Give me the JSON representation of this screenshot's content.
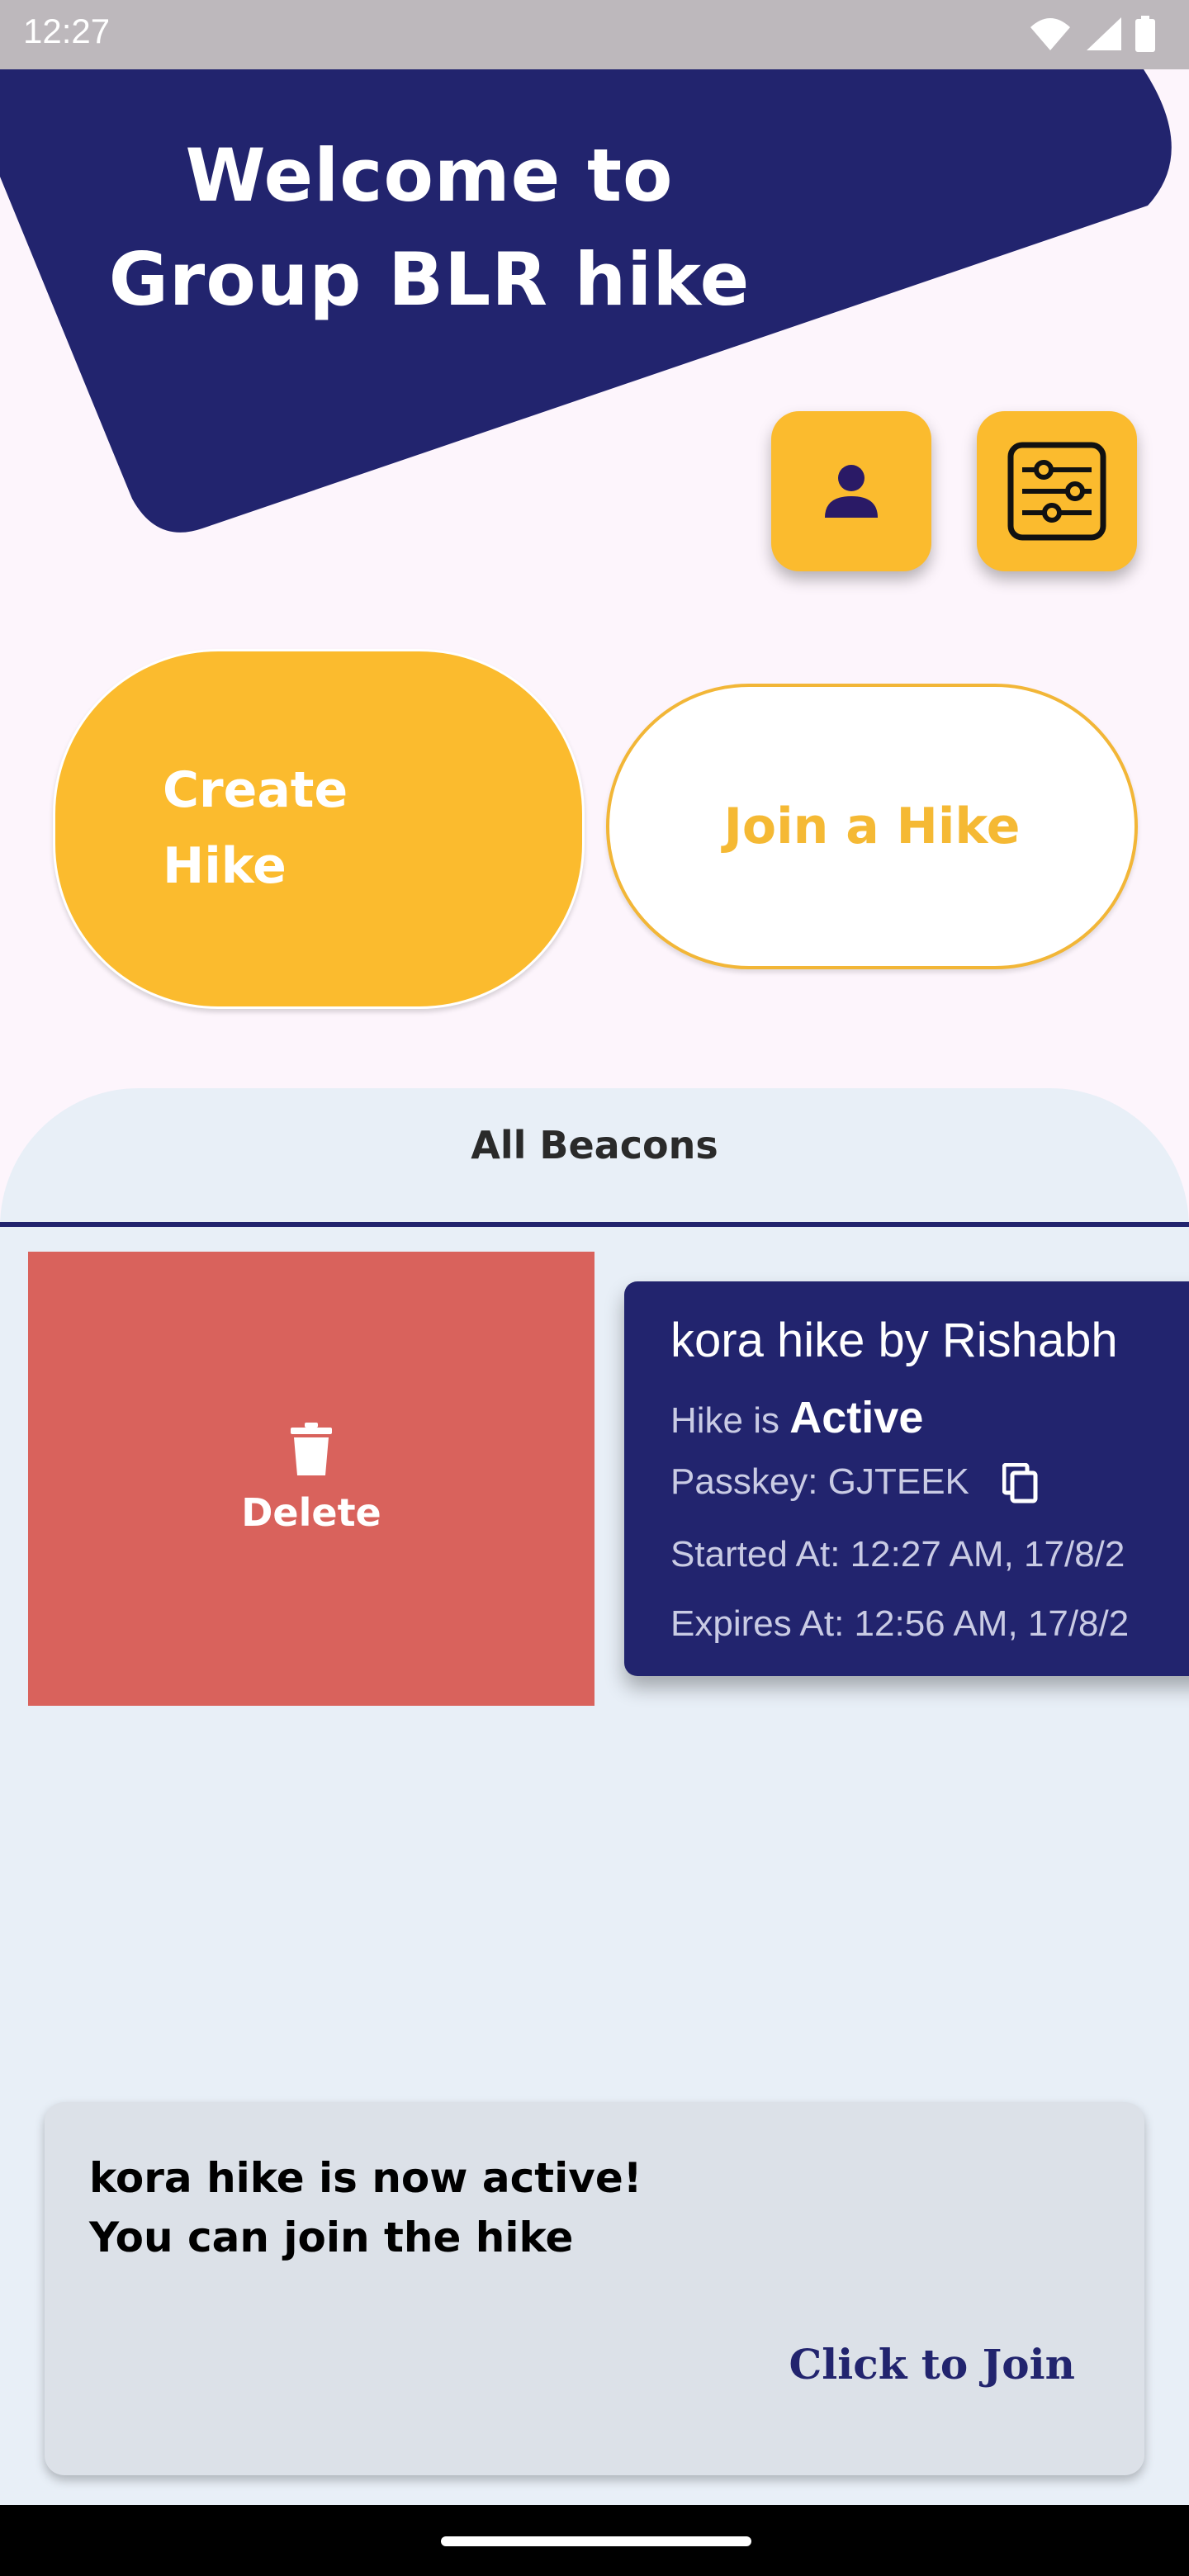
{
  "status_bar": {
    "time": "12:27",
    "icons": [
      "wifi-icon",
      "signal-icon",
      "battery-icon"
    ]
  },
  "header": {
    "welcome_line1": "Welcome to",
    "welcome_line2": "Group BLR hike"
  },
  "icons": {
    "profile": "person-icon",
    "filter": "sliders-icon",
    "delete": "trash-icon",
    "copy": "copy-icon"
  },
  "actions": {
    "create_line1": "Create",
    "create_line2": "Hike",
    "join_label": "Join a Hike"
  },
  "beacons": {
    "title": "All Beacons",
    "delete_label": "Delete",
    "card": {
      "title": "kora hike  by Rishabh",
      "status_prefix": "Hike is",
      "status_value": "Active",
      "passkey": "Passkey: GJTEEK",
      "started": "Started At: 12:27 AM, 17/8/2",
      "expires": "Expires At: 12:56 AM, 17/8/2"
    }
  },
  "toast": {
    "line1": "kora hike  is now active!",
    "line2": "You can join the hike",
    "action": "Click to Join"
  },
  "colors": {
    "navy": "#22246e",
    "amber": "#fbbb2e",
    "delete_red": "#d9625c",
    "light_bg": "#e8eff7"
  }
}
